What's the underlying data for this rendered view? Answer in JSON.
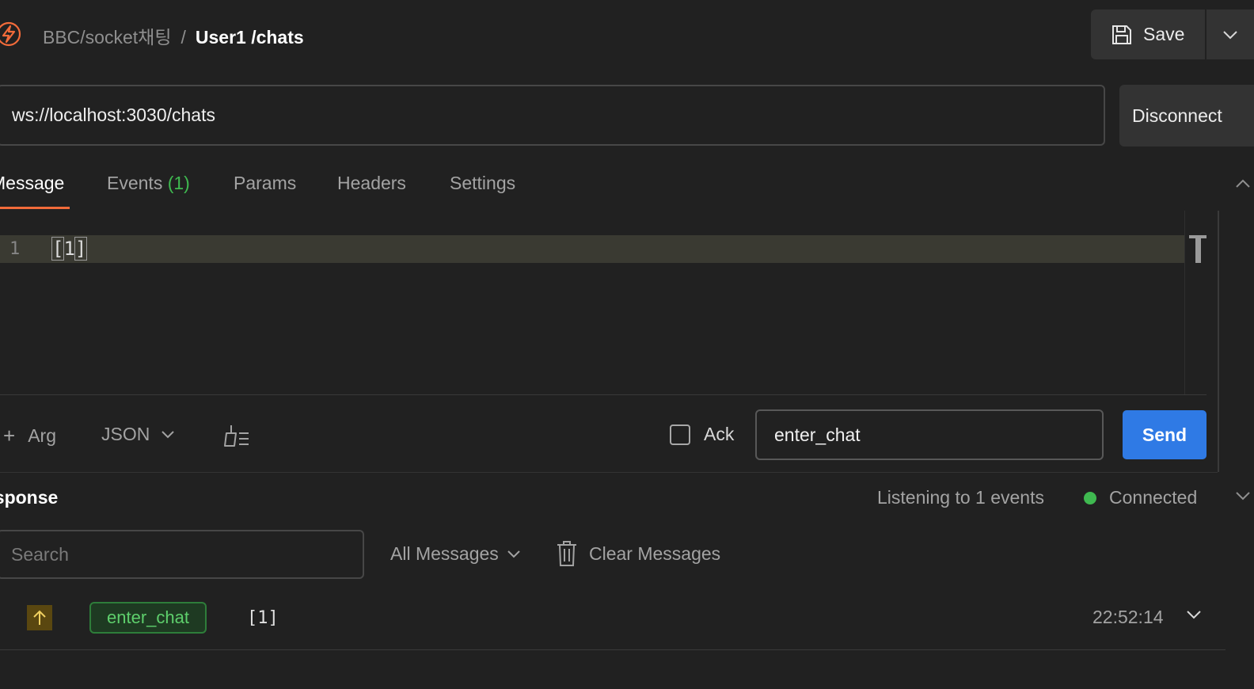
{
  "header": {
    "collection": "BBC/socket채팅",
    "separator": "/",
    "request_name": "User1 /chats",
    "save_label": "Save"
  },
  "url_bar": {
    "url": "ws://localhost:3030/chats",
    "disconnect_label": "Disconnect"
  },
  "tabs": [
    {
      "label": "Message",
      "active": true
    },
    {
      "label": "Events",
      "count": "(1)"
    },
    {
      "label": "Params"
    },
    {
      "label": "Headers"
    },
    {
      "label": "Settings"
    }
  ],
  "editor": {
    "line_number": "1",
    "bracket_open": "[",
    "content": "1",
    "bracket_close": "]"
  },
  "toolbar": {
    "add_arg_label": "Arg",
    "format": "JSON",
    "ack_label": "Ack",
    "event_name": "enter_chat",
    "send_label": "Send"
  },
  "response": {
    "title": "esponse",
    "listening": "Listening to 1 events",
    "status": "Connected",
    "search_placeholder": "Search",
    "filter": "All Messages",
    "clear_label": "Clear Messages",
    "messages": [
      {
        "direction": "sent",
        "event": "enter_chat",
        "payload": "[1]",
        "time": "22:52:14"
      }
    ]
  },
  "colors": {
    "accent": "#f26b3a",
    "send_button": "#2f7ae5",
    "connected": "#3fb950"
  }
}
